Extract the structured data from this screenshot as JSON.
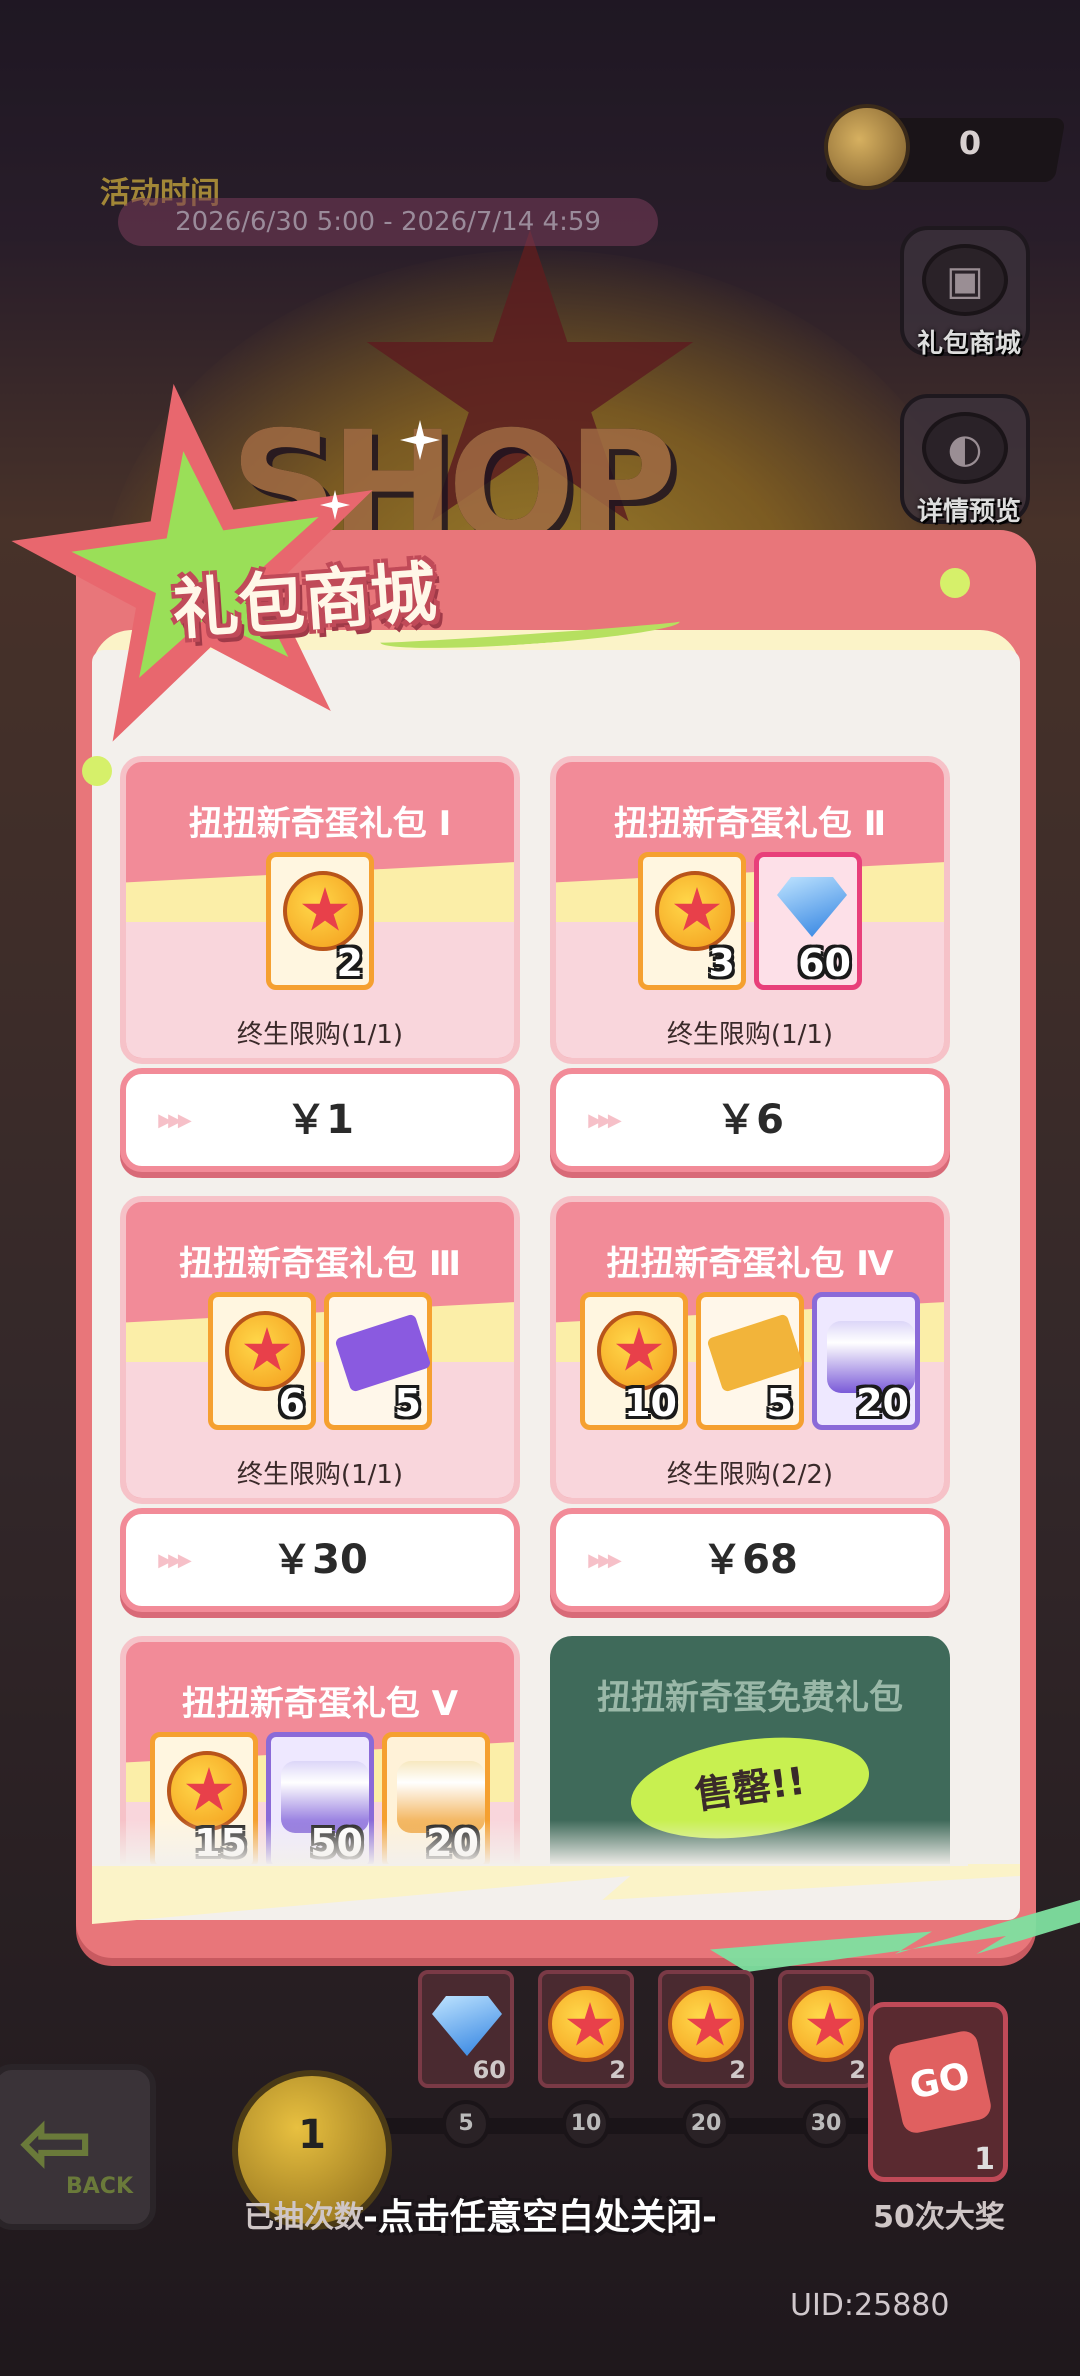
{
  "event": {
    "label": "活动时间",
    "time_range": "2026/6/30 5:00 - 2026/7/14 4:59"
  },
  "currency": {
    "value": "0",
    "icon": "coin-icon"
  },
  "side_buttons": [
    {
      "label": "礼包商城",
      "icon": "gift-icon"
    },
    {
      "label": "详情预览",
      "icon": "preview-icon"
    }
  ],
  "background": {
    "shop_text": "SHOP"
  },
  "popup": {
    "title": "礼包商城",
    "packs": [
      {
        "name": "扭扭新奇蛋礼包 Ⅰ",
        "items": [
          {
            "icon": "star-badge-icon",
            "count": "2"
          }
        ],
        "limit": "终生限购(1/1)",
        "price": "￥1"
      },
      {
        "name": "扭扭新奇蛋礼包 Ⅱ",
        "items": [
          {
            "icon": "star-badge-icon",
            "count": "3"
          },
          {
            "icon": "diamond-icon",
            "count": "60"
          }
        ],
        "limit": "终生限购(1/1)",
        "price": "￥6"
      },
      {
        "name": "扭扭新奇蛋礼包 Ⅲ",
        "items": [
          {
            "icon": "star-badge-icon",
            "count": "6"
          },
          {
            "icon": "purple-ticket-icon",
            "count": "5"
          }
        ],
        "limit": "终生限购(1/1)",
        "price": "￥30"
      },
      {
        "name": "扭扭新奇蛋礼包 Ⅳ",
        "items": [
          {
            "icon": "star-badge-icon",
            "count": "10"
          },
          {
            "icon": "gold-ticket-icon",
            "count": "5"
          },
          {
            "icon": "purple-can-icon",
            "count": "20"
          }
        ],
        "limit": "终生限购(2/2)",
        "price": "￥68"
      },
      {
        "name": "扭扭新奇蛋礼包 Ⅴ",
        "items": [
          {
            "icon": "star-badge-icon",
            "count": "15"
          },
          {
            "icon": "purple-can-icon",
            "count": "50"
          },
          {
            "icon": "orange-can-icon",
            "count": "20"
          }
        ]
      }
    ],
    "free_pack": {
      "name": "扭扭新奇蛋免费礼包",
      "status": "售罄!!"
    }
  },
  "progress": {
    "drawn_count": "1",
    "drawn_label": "已抽次数",
    "rewards": [
      {
        "icon": "diamond-icon",
        "count": "60"
      },
      {
        "icon": "star-badge-icon",
        "count": "2"
      },
      {
        "icon": "star-badge-icon",
        "count": "2"
      },
      {
        "icon": "star-badge-icon",
        "count": "2"
      }
    ],
    "milestones": [
      "5",
      "10",
      "20",
      "30"
    ],
    "grand_prize": {
      "label": "50次大奖",
      "count": "1",
      "icon": "dice-icon",
      "dice_text": "GO"
    }
  },
  "back_button": {
    "label": "BACK",
    "icon": "back-arrow-icon"
  },
  "close_hint": "-点击任意空白处关闭-",
  "uid": "UID:25880"
}
